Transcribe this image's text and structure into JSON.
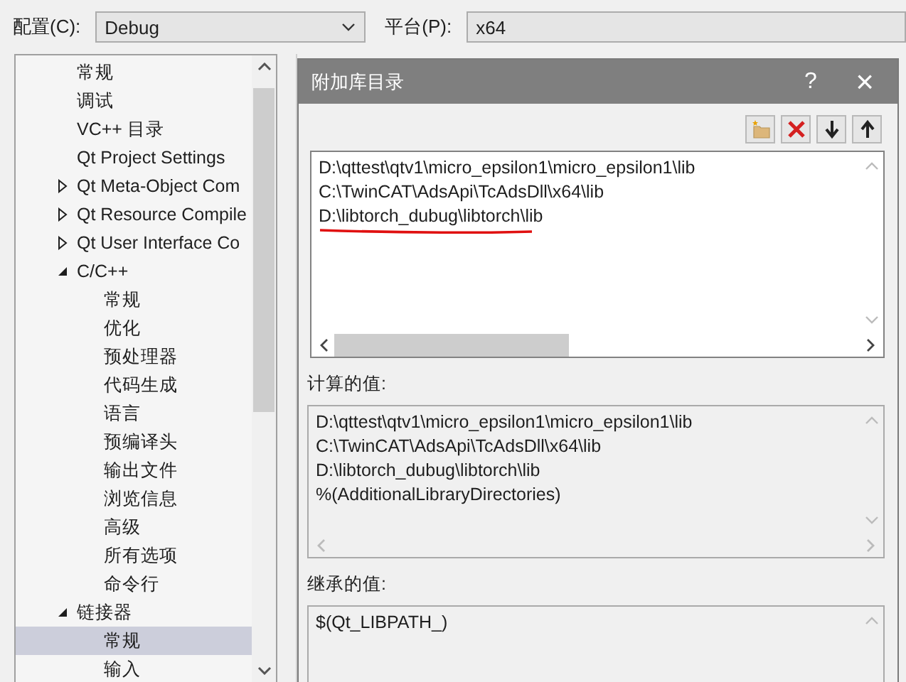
{
  "toolbar": {
    "config_label": "配置(C):",
    "config_value": "Debug",
    "platform_label": "平台(P):",
    "platform_value": "x64"
  },
  "tree": [
    {
      "label": "常规"
    },
    {
      "label": "调试"
    },
    {
      "label": "VC++ 目录"
    },
    {
      "label": "Qt Project Settings"
    },
    {
      "label": "Qt Meta-Object Com",
      "expanded": false
    },
    {
      "label": "Qt Resource Compile",
      "expanded": false
    },
    {
      "label": "Qt User Interface Co",
      "expanded": false
    },
    {
      "label": "C/C++",
      "expanded": true,
      "children": [
        {
          "label": "常规",
          "selected": false
        },
        {
          "label": "优化",
          "selected": false
        },
        {
          "label": "预处理器",
          "selected": false
        },
        {
          "label": "代码生成",
          "selected": false
        },
        {
          "label": "语言",
          "selected": false
        },
        {
          "label": "预编译头",
          "selected": false
        },
        {
          "label": "输出文件",
          "selected": false
        },
        {
          "label": "浏览信息",
          "selected": false
        },
        {
          "label": "高级",
          "selected": false
        },
        {
          "label": "所有选项",
          "selected": false
        },
        {
          "label": "命令行",
          "selected": false
        }
      ]
    },
    {
      "label": "链接器",
      "expanded": true,
      "children": [
        {
          "label": "常规",
          "selected": true
        },
        {
          "label": "输入",
          "selected": false
        }
      ]
    }
  ],
  "dialog": {
    "title": "附加库目录",
    "help": "?",
    "close": "×",
    "entries": [
      {
        "text": "D:\\qttest\\qtv1\\micro_epsilon1\\micro_epsilon1\\lib",
        "underlined": false
      },
      {
        "text": "C:\\TwinCAT\\AdsApi\\TcAdsDll\\x64\\lib",
        "underlined": false
      },
      {
        "text": "D:\\libtorch_dubug\\libtorch\\lib",
        "underlined": true
      }
    ],
    "computed_label": "计算的值:",
    "computed": [
      "D:\\qttest\\qtv1\\micro_epsilon1\\micro_epsilon1\\lib",
      "C:\\TwinCAT\\AdsApi\\TcAdsDll\\x64\\lib",
      "D:\\libtorch_dubug\\libtorch\\lib",
      "%(AdditionalLibraryDirectories)"
    ],
    "inherited_label": "继承的值:",
    "inherited": [
      "$(Qt_LIBPATH_)"
    ]
  }
}
